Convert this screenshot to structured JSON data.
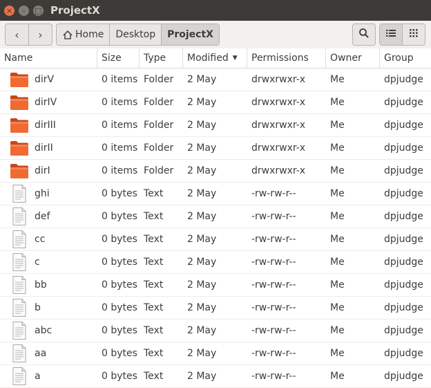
{
  "window": {
    "title": "ProjectX"
  },
  "window_controls": {
    "close": "×",
    "minimize": "–",
    "maximize": "□"
  },
  "toolbar": {
    "back": "‹",
    "forward": "›",
    "breadcrumbs": [
      "Home",
      "Desktop",
      "ProjectX"
    ]
  },
  "columns": {
    "name": "Name",
    "size": "Size",
    "type": "Type",
    "modified": "Modified",
    "permissions": "Permissions",
    "owner": "Owner",
    "group": "Group"
  },
  "files": [
    {
      "icon": "folder-icon",
      "name": "dirV",
      "size": "0 items",
      "type": "Folder",
      "modified": "2 May",
      "permissions": "drwxrwxr-x",
      "owner": "Me",
      "group": "dpjudge"
    },
    {
      "icon": "folder-icon",
      "name": "dirIV",
      "size": "0 items",
      "type": "Folder",
      "modified": "2 May",
      "permissions": "drwxrwxr-x",
      "owner": "Me",
      "group": "dpjudge"
    },
    {
      "icon": "folder-icon",
      "name": "dirIII",
      "size": "0 items",
      "type": "Folder",
      "modified": "2 May",
      "permissions": "drwxrwxr-x",
      "owner": "Me",
      "group": "dpjudge"
    },
    {
      "icon": "folder-icon",
      "name": "dirII",
      "size": "0 items",
      "type": "Folder",
      "modified": "2 May",
      "permissions": "drwxrwxr-x",
      "owner": "Me",
      "group": "dpjudge"
    },
    {
      "icon": "folder-icon",
      "name": "dirI",
      "size": "0 items",
      "type": "Folder",
      "modified": "2 May",
      "permissions": "drwxrwxr-x",
      "owner": "Me",
      "group": "dpjudge"
    },
    {
      "icon": "text-file-icon",
      "name": "ghi",
      "size": "0 bytes",
      "type": "Text",
      "modified": "2 May",
      "permissions": "-rw-rw-r--",
      "owner": "Me",
      "group": "dpjudge"
    },
    {
      "icon": "text-file-icon",
      "name": "def",
      "size": "0 bytes",
      "type": "Text",
      "modified": "2 May",
      "permissions": "-rw-rw-r--",
      "owner": "Me",
      "group": "dpjudge"
    },
    {
      "icon": "text-file-icon",
      "name": "cc",
      "size": "0 bytes",
      "type": "Text",
      "modified": "2 May",
      "permissions": "-rw-rw-r--",
      "owner": "Me",
      "group": "dpjudge"
    },
    {
      "icon": "text-file-icon",
      "name": "c",
      "size": "0 bytes",
      "type": "Text",
      "modified": "2 May",
      "permissions": "-rw-rw-r--",
      "owner": "Me",
      "group": "dpjudge"
    },
    {
      "icon": "text-file-icon",
      "name": "bb",
      "size": "0 bytes",
      "type": "Text",
      "modified": "2 May",
      "permissions": "-rw-rw-r--",
      "owner": "Me",
      "group": "dpjudge"
    },
    {
      "icon": "text-file-icon",
      "name": "b",
      "size": "0 bytes",
      "type": "Text",
      "modified": "2 May",
      "permissions": "-rw-rw-r--",
      "owner": "Me",
      "group": "dpjudge"
    },
    {
      "icon": "text-file-icon",
      "name": "abc",
      "size": "0 bytes",
      "type": "Text",
      "modified": "2 May",
      "permissions": "-rw-rw-r--",
      "owner": "Me",
      "group": "dpjudge"
    },
    {
      "icon": "text-file-icon",
      "name": "aa",
      "size": "0 bytes",
      "type": "Text",
      "modified": "2 May",
      "permissions": "-rw-rw-r--",
      "owner": "Me",
      "group": "dpjudge"
    },
    {
      "icon": "text-file-icon",
      "name": "a",
      "size": "0 bytes",
      "type": "Text",
      "modified": "2 May",
      "permissions": "-rw-rw-r--",
      "owner": "Me",
      "group": "dpjudge"
    }
  ],
  "colors": {
    "titlebar": "#3c3b37",
    "close": "#e8704a",
    "folder": "#e95420"
  }
}
